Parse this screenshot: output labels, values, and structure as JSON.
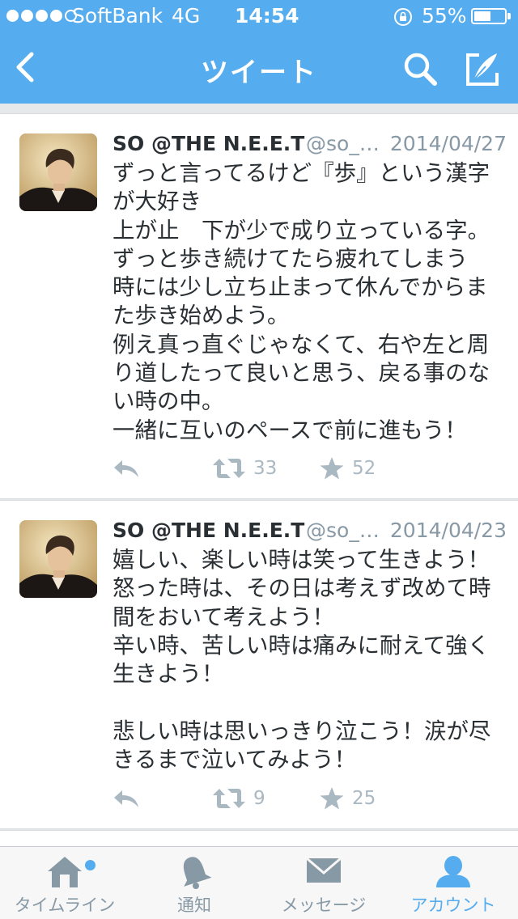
{
  "status_bar": {
    "carrier": "SoftBank",
    "network": "4G",
    "time": "14:54",
    "battery": "55%",
    "battery_level": 0.55,
    "signal_bars_filled": 4,
    "signal_bars_total": 5
  },
  "nav": {
    "title": "ツイート",
    "back_icon": "chevron-left-icon",
    "search_icon": "search-icon",
    "compose_icon": "compose-icon"
  },
  "tweets": [
    {
      "name": "SO @THE N.E.E.T",
      "handle": "@so_…",
      "date": "2014/04/27",
      "text": "ずっと言ってるけど『歩』という漢字が大好き\n上が止　下が少で成り立っている字。\nずっと歩き続けてたら疲れてしまう\n時には少し立ち止まって休んでからまた歩き始めよう。\n例え真っ直ぐじゃなくて、右や左と周り道したって良いと思う、戻る事のない時の中。\n一緒に互いのペースで前に進もう！",
      "retweets": "33",
      "favorites": "52"
    },
    {
      "name": "SO @THE N.E.E.T",
      "handle": "@so_…",
      "date": "2014/04/23",
      "text": "嬉しい、楽しい時は笑って生きよう！\n怒った時は、その日は考えず改めて時間をおいて考えよう！\n辛い時、苦しい時は痛みに耐えて強く生きよう！\n\n悲しい時は思いっきり泣こう！涙が尽きるまで泣いてみよう！",
      "retweets": "9",
      "favorites": "25"
    }
  ],
  "tabs": [
    {
      "label": "タイムライン",
      "icon": "home-icon",
      "has_notification_dot": true
    },
    {
      "label": "通知",
      "icon": "bell-icon"
    },
    {
      "label": "メッセージ",
      "icon": "envelope-icon"
    },
    {
      "label": "アカウント",
      "icon": "person-icon",
      "active": true
    }
  ],
  "colors": {
    "brand": "#55acee",
    "text": "#292f33",
    "muted": "#8899a6",
    "action": "#aab8c2"
  }
}
